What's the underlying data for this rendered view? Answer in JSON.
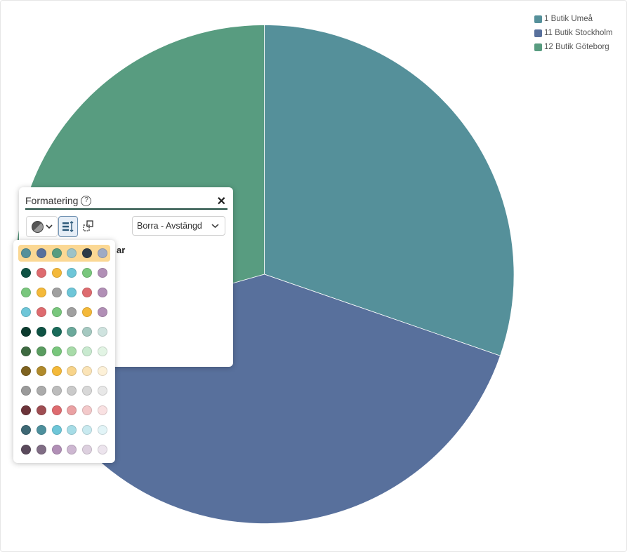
{
  "chart_data": {
    "type": "pie",
    "series": [
      {
        "labels": [
          "1 Butik Umeå",
          "11 Butik Stockholm",
          "12 Butik Göteborg"
        ],
        "values": [
          30.3,
          40.3,
          29.4
        ],
        "colors": [
          "#55909a",
          "#58709c",
          "#589c80"
        ]
      }
    ],
    "legend_position": "top-right"
  },
  "legend": {
    "items": [
      {
        "label": "1 Butik Umeå",
        "color": "#55909a"
      },
      {
        "label": "11 Butik Stockholm",
        "color": "#58709c"
      },
      {
        "label": "12 Butik Göteborg",
        "color": "#589c80"
      }
    ]
  },
  "format_panel": {
    "title": "Formatering",
    "help_icon": "?",
    "close_icon": "✕",
    "drill_select_value": "Borra - Avstängd",
    "partial_text": "ar"
  },
  "palette": {
    "selected_row": 0,
    "rows": [
      [
        "#55909a",
        "#58709c",
        "#589c80",
        "#9cc3c8",
        "#2e3c48",
        "#9eaac4"
      ],
      [
        "#0f5244",
        "#de6b6f",
        "#f4b93a",
        "#6ec6d8",
        "#79c77d",
        "#b18fb6"
      ],
      [
        "#79c77d",
        "#f4b93a",
        "#a0a0a0",
        "#6ec6d8",
        "#de6b6f",
        "#b18fb6"
      ],
      [
        "#6ec6d8",
        "#de6b6f",
        "#79c77d",
        "#a0a0a0",
        "#f4b93a",
        "#b18fb6"
      ],
      [
        "#0c3b2f",
        "#0f5244",
        "#1a6b5a",
        "#6ba99b",
        "#a5c9c1",
        "#cfe3df"
      ],
      [
        "#3e6a41",
        "#5a9c60",
        "#79c77d",
        "#a8dba9",
        "#c9ead0",
        "#e2f4e4"
      ],
      [
        "#7e6220",
        "#b08a2b",
        "#f4b93a",
        "#f8d48a",
        "#fbe4b7",
        "#fdf1d8"
      ],
      [
        "#9a9a9a",
        "#ababab",
        "#bcbcbc",
        "#cacaca",
        "#d8d8d8",
        "#e8e8e8"
      ],
      [
        "#6c343a",
        "#9e4d52",
        "#de6b6f",
        "#eaa1a3",
        "#f3c9ca",
        "#f9e1e2"
      ],
      [
        "#3e6874",
        "#4d8f9c",
        "#6ec6d8",
        "#a6dce6",
        "#c9eaf0",
        "#e2f4f7"
      ],
      [
        "#5a4a5c",
        "#806d85",
        "#b18fb6",
        "#cdb7d1",
        "#ddd0df",
        "#ece4ed"
      ]
    ]
  }
}
